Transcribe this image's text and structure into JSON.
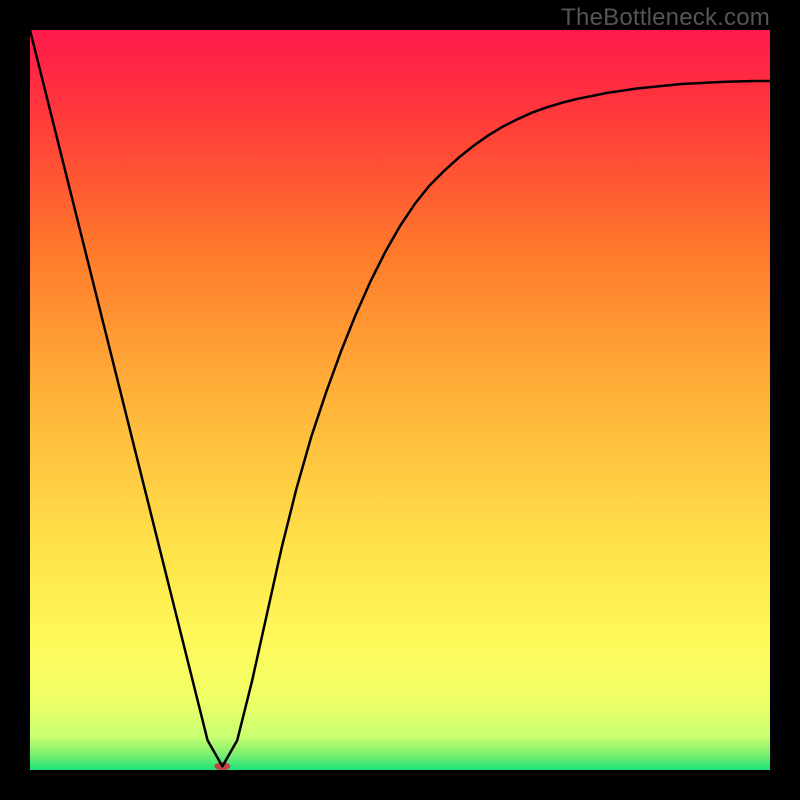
{
  "watermark": "TheBottleneck.com",
  "chart_data": {
    "type": "line",
    "title": "",
    "xlabel": "",
    "ylabel": "",
    "xlim": [
      0,
      100
    ],
    "ylim": [
      0,
      100
    ],
    "grid": false,
    "background_gradient": {
      "stops": [
        {
          "offset": 0.0,
          "color": "#ff1a4b"
        },
        {
          "offset": 0.12,
          "color": "#ff3a3a"
        },
        {
          "offset": 0.3,
          "color": "#ff7a2b"
        },
        {
          "offset": 0.5,
          "color": "#ffb33a"
        },
        {
          "offset": 0.7,
          "color": "#ffe24a"
        },
        {
          "offset": 0.82,
          "color": "#fff85a"
        },
        {
          "offset": 0.9,
          "color": "#f2ff66"
        },
        {
          "offset": 0.955,
          "color": "#c8ff70"
        },
        {
          "offset": 0.978,
          "color": "#7eef6e"
        },
        {
          "offset": 1.0,
          "color": "#1de47a"
        }
      ]
    },
    "series": [
      {
        "name": "curve",
        "color": "#000000",
        "width": 2.5,
        "x": [
          0,
          2,
          4,
          6,
          8,
          10,
          12,
          14,
          16,
          18,
          20,
          22,
          24,
          26,
          28,
          30,
          32,
          34,
          36,
          38,
          40,
          42,
          44,
          46,
          48,
          50,
          52,
          54,
          56,
          58,
          60,
          62,
          64,
          66,
          68,
          70,
          72,
          74,
          76,
          78,
          80,
          82,
          84,
          86,
          88,
          90,
          92,
          94,
          96,
          98,
          100
        ],
        "y": [
          100,
          92,
          84,
          76,
          68,
          60,
          52,
          44,
          36,
          28,
          20,
          12,
          4,
          0.5,
          4,
          12,
          21,
          30,
          38,
          45,
          51,
          56.5,
          61.5,
          66,
          70,
          73.5,
          76.5,
          79,
          81,
          82.8,
          84.4,
          85.8,
          87,
          88,
          88.9,
          89.6,
          90.2,
          90.7,
          91.1,
          91.5,
          91.8,
          92.1,
          92.3,
          92.5,
          92.7,
          92.8,
          92.9,
          93.0,
          93.05,
          93.1,
          93.1
        ]
      }
    ],
    "marker": {
      "name": "min-marker",
      "x": 26,
      "y": 0.5,
      "color": "#c04545",
      "rx": 8,
      "ry": 4
    }
  }
}
